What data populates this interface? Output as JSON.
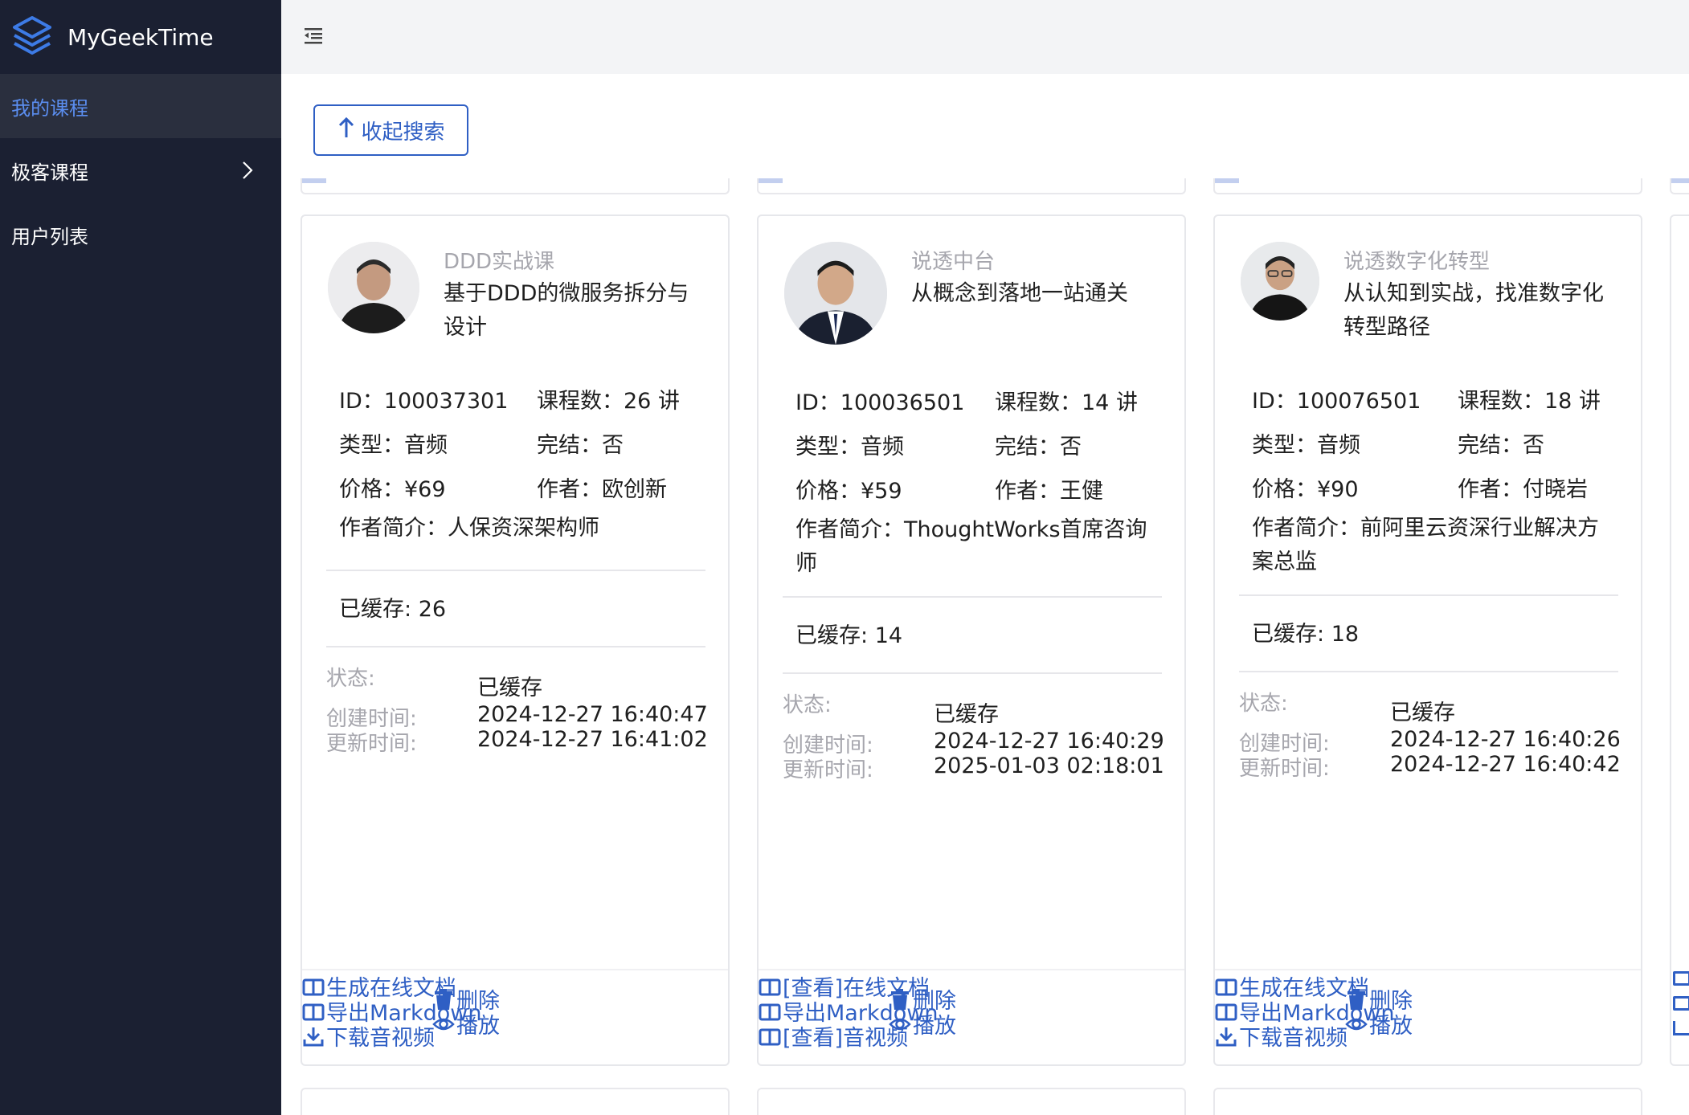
{
  "app": {
    "name": "MyGeekTime"
  },
  "sidebar": {
    "items": [
      {
        "label": "我的课程"
      },
      {
        "label": "极客课程"
      },
      {
        "label": "用户列表"
      }
    ]
  },
  "toolbar": {
    "toggle_search_label": "收起搜索"
  },
  "labels": {
    "id": "ID：",
    "lessons": "课程数：",
    "type": "类型：",
    "finished": "完结：",
    "price": "价格：",
    "author": "作者：",
    "intro": "作者简介：",
    "cached": "已缓存: ",
    "status": "状态:",
    "created": "创建时间:",
    "updated": "更新时间:"
  },
  "colors": {
    "sidebar_bg": "#1b2032",
    "accent": "#2f5fc4",
    "active_text": "#5b8ef0"
  },
  "cards": [
    {
      "subtitle": "DDD实战课",
      "title": "基于DDD的微服务拆分与设计",
      "id": "100037301",
      "lessons": "26 讲",
      "type": "音频",
      "finished": "否",
      "price": "¥69",
      "author": "欧创新",
      "intro": "人保资深架构师",
      "cached": "26",
      "status": "已缓存",
      "created": "2024-12-27 16:40:47",
      "updated": "2024-12-27 16:41:02",
      "actions": {
        "doc": "生成在线文档",
        "markdown": "导出Markdown",
        "media": "下载音视频",
        "delete": "删除",
        "play": "播放"
      }
    },
    {
      "subtitle": "说透中台",
      "title": "从概念到落地一站通关",
      "id": "100036501",
      "lessons": "14 讲",
      "type": "音频",
      "finished": "否",
      "price": "¥59",
      "author": "王健",
      "intro": "ThoughtWorks首席咨询师",
      "cached": "14",
      "status": "已缓存",
      "created": "2024-12-27 16:40:29",
      "updated": "2025-01-03 02:18:01",
      "actions": {
        "doc": "[查看]在线文档",
        "markdown": "导出Markdown",
        "media": "[查看]音视频",
        "delete": "删除",
        "play": "播放"
      }
    },
    {
      "subtitle": "说透数字化转型",
      "title": "从认知到实战，找准数字化转型路径",
      "id": "100076501",
      "lessons": "18 讲",
      "type": "音频",
      "finished": "否",
      "price": "¥90",
      "author": "付晓岩",
      "intro": "前阿里云资深行业解决方案总监",
      "cached": "18",
      "status": "已缓存",
      "created": "2024-12-27 16:40:26",
      "updated": "2024-12-27 16:40:42",
      "actions": {
        "doc": "生成在线文档",
        "markdown": "导出Markdown",
        "media": "下载音视频",
        "delete": "删除",
        "play": "播放"
      }
    }
  ]
}
